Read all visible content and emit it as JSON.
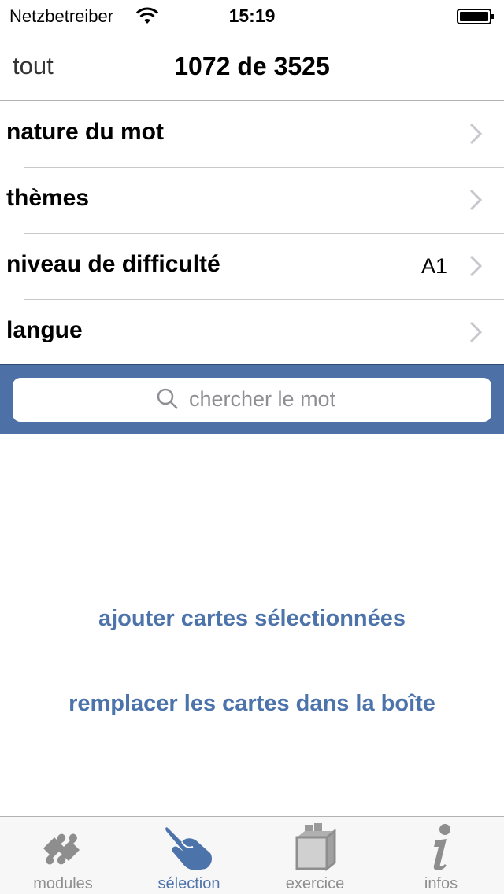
{
  "status_bar": {
    "carrier": "Netzbetreiber",
    "time": "15:19"
  },
  "nav": {
    "left_label": "tout",
    "title": "1072 de 3525"
  },
  "filters": [
    {
      "label": "nature du mot",
      "value": ""
    },
    {
      "label": "thèmes",
      "value": ""
    },
    {
      "label": "niveau de difficulté",
      "value": "A1"
    },
    {
      "label": "langue",
      "value": ""
    }
  ],
  "search": {
    "placeholder": "chercher le mot"
  },
  "actions": {
    "add": "ajouter cartes sélectionnées",
    "replace": "remplacer les cartes dans la boîte"
  },
  "tabs": [
    {
      "label": "modules",
      "icon": "puzzle-icon",
      "active": false
    },
    {
      "label": "sélection",
      "icon": "hand-icon",
      "active": true
    },
    {
      "label": "exercice",
      "icon": "card-box-icon",
      "active": false
    },
    {
      "label": "infos",
      "icon": "info-icon",
      "active": false
    }
  ],
  "colors": {
    "accent": "#4d73ab",
    "search_bar_bg": "#4d71a7",
    "inactive_tab": "#8e8e8e"
  }
}
